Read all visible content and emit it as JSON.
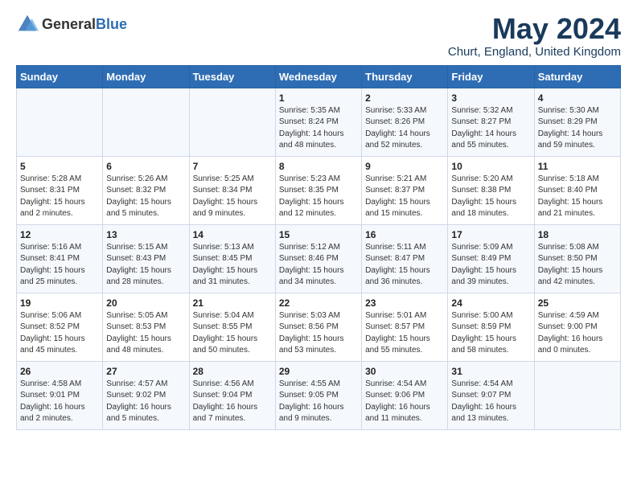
{
  "header": {
    "logo_general": "General",
    "logo_blue": "Blue",
    "title": "May 2024",
    "subtitle": "Churt, England, United Kingdom"
  },
  "days_of_week": [
    "Sunday",
    "Monday",
    "Tuesday",
    "Wednesday",
    "Thursday",
    "Friday",
    "Saturday"
  ],
  "weeks": [
    {
      "cells": [
        {
          "day": "",
          "info": ""
        },
        {
          "day": "",
          "info": ""
        },
        {
          "day": "",
          "info": ""
        },
        {
          "day": "1",
          "info": "Sunrise: 5:35 AM\nSunset: 8:24 PM\nDaylight: 14 hours\nand 48 minutes."
        },
        {
          "day": "2",
          "info": "Sunrise: 5:33 AM\nSunset: 8:26 PM\nDaylight: 14 hours\nand 52 minutes."
        },
        {
          "day": "3",
          "info": "Sunrise: 5:32 AM\nSunset: 8:27 PM\nDaylight: 14 hours\nand 55 minutes."
        },
        {
          "day": "4",
          "info": "Sunrise: 5:30 AM\nSunset: 8:29 PM\nDaylight: 14 hours\nand 59 minutes."
        }
      ]
    },
    {
      "cells": [
        {
          "day": "5",
          "info": "Sunrise: 5:28 AM\nSunset: 8:31 PM\nDaylight: 15 hours\nand 2 minutes."
        },
        {
          "day": "6",
          "info": "Sunrise: 5:26 AM\nSunset: 8:32 PM\nDaylight: 15 hours\nand 5 minutes."
        },
        {
          "day": "7",
          "info": "Sunrise: 5:25 AM\nSunset: 8:34 PM\nDaylight: 15 hours\nand 9 minutes."
        },
        {
          "day": "8",
          "info": "Sunrise: 5:23 AM\nSunset: 8:35 PM\nDaylight: 15 hours\nand 12 minutes."
        },
        {
          "day": "9",
          "info": "Sunrise: 5:21 AM\nSunset: 8:37 PM\nDaylight: 15 hours\nand 15 minutes."
        },
        {
          "day": "10",
          "info": "Sunrise: 5:20 AM\nSunset: 8:38 PM\nDaylight: 15 hours\nand 18 minutes."
        },
        {
          "day": "11",
          "info": "Sunrise: 5:18 AM\nSunset: 8:40 PM\nDaylight: 15 hours\nand 21 minutes."
        }
      ]
    },
    {
      "cells": [
        {
          "day": "12",
          "info": "Sunrise: 5:16 AM\nSunset: 8:41 PM\nDaylight: 15 hours\nand 25 minutes."
        },
        {
          "day": "13",
          "info": "Sunrise: 5:15 AM\nSunset: 8:43 PM\nDaylight: 15 hours\nand 28 minutes."
        },
        {
          "day": "14",
          "info": "Sunrise: 5:13 AM\nSunset: 8:45 PM\nDaylight: 15 hours\nand 31 minutes."
        },
        {
          "day": "15",
          "info": "Sunrise: 5:12 AM\nSunset: 8:46 PM\nDaylight: 15 hours\nand 34 minutes."
        },
        {
          "day": "16",
          "info": "Sunrise: 5:11 AM\nSunset: 8:47 PM\nDaylight: 15 hours\nand 36 minutes."
        },
        {
          "day": "17",
          "info": "Sunrise: 5:09 AM\nSunset: 8:49 PM\nDaylight: 15 hours\nand 39 minutes."
        },
        {
          "day": "18",
          "info": "Sunrise: 5:08 AM\nSunset: 8:50 PM\nDaylight: 15 hours\nand 42 minutes."
        }
      ]
    },
    {
      "cells": [
        {
          "day": "19",
          "info": "Sunrise: 5:06 AM\nSunset: 8:52 PM\nDaylight: 15 hours\nand 45 minutes."
        },
        {
          "day": "20",
          "info": "Sunrise: 5:05 AM\nSunset: 8:53 PM\nDaylight: 15 hours\nand 48 minutes."
        },
        {
          "day": "21",
          "info": "Sunrise: 5:04 AM\nSunset: 8:55 PM\nDaylight: 15 hours\nand 50 minutes."
        },
        {
          "day": "22",
          "info": "Sunrise: 5:03 AM\nSunset: 8:56 PM\nDaylight: 15 hours\nand 53 minutes."
        },
        {
          "day": "23",
          "info": "Sunrise: 5:01 AM\nSunset: 8:57 PM\nDaylight: 15 hours\nand 55 minutes."
        },
        {
          "day": "24",
          "info": "Sunrise: 5:00 AM\nSunset: 8:59 PM\nDaylight: 15 hours\nand 58 minutes."
        },
        {
          "day": "25",
          "info": "Sunrise: 4:59 AM\nSunset: 9:00 PM\nDaylight: 16 hours\nand 0 minutes."
        }
      ]
    },
    {
      "cells": [
        {
          "day": "26",
          "info": "Sunrise: 4:58 AM\nSunset: 9:01 PM\nDaylight: 16 hours\nand 2 minutes."
        },
        {
          "day": "27",
          "info": "Sunrise: 4:57 AM\nSunset: 9:02 PM\nDaylight: 16 hours\nand 5 minutes."
        },
        {
          "day": "28",
          "info": "Sunrise: 4:56 AM\nSunset: 9:04 PM\nDaylight: 16 hours\nand 7 minutes."
        },
        {
          "day": "29",
          "info": "Sunrise: 4:55 AM\nSunset: 9:05 PM\nDaylight: 16 hours\nand 9 minutes."
        },
        {
          "day": "30",
          "info": "Sunrise: 4:54 AM\nSunset: 9:06 PM\nDaylight: 16 hours\nand 11 minutes."
        },
        {
          "day": "31",
          "info": "Sunrise: 4:54 AM\nSunset: 9:07 PM\nDaylight: 16 hours\nand 13 minutes."
        },
        {
          "day": "",
          "info": ""
        }
      ]
    }
  ]
}
